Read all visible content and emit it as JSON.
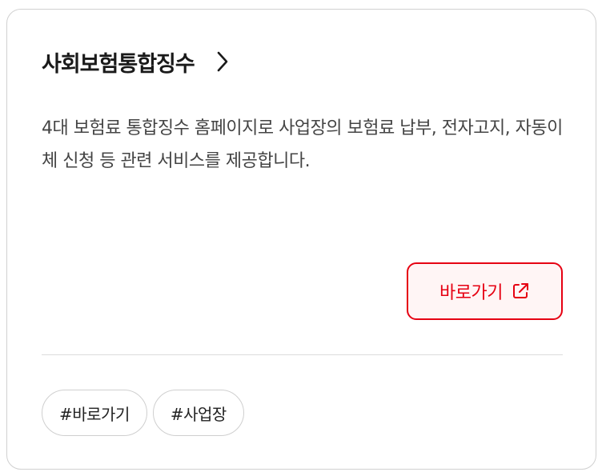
{
  "card": {
    "title": "사회보험통합징수",
    "title_link_icon": "chevron-right-icon",
    "description": "4대 보험료 통합징수 홈페이지로 사업장의 보험료 납부, 전자고지, 자동이체 신청 등 관련 서비스를 제공합니다.",
    "go_button": {
      "label": "바로가기",
      "icon": "external-link-icon"
    },
    "tags": [
      {
        "label": "#바로가기"
      },
      {
        "label": "#사업장"
      }
    ]
  },
  "colors": {
    "accent": "#e60012",
    "accent_bg": "#fff5f5",
    "title": "#1a1a1a",
    "text": "#444444",
    "border": "#d0d0d0"
  }
}
